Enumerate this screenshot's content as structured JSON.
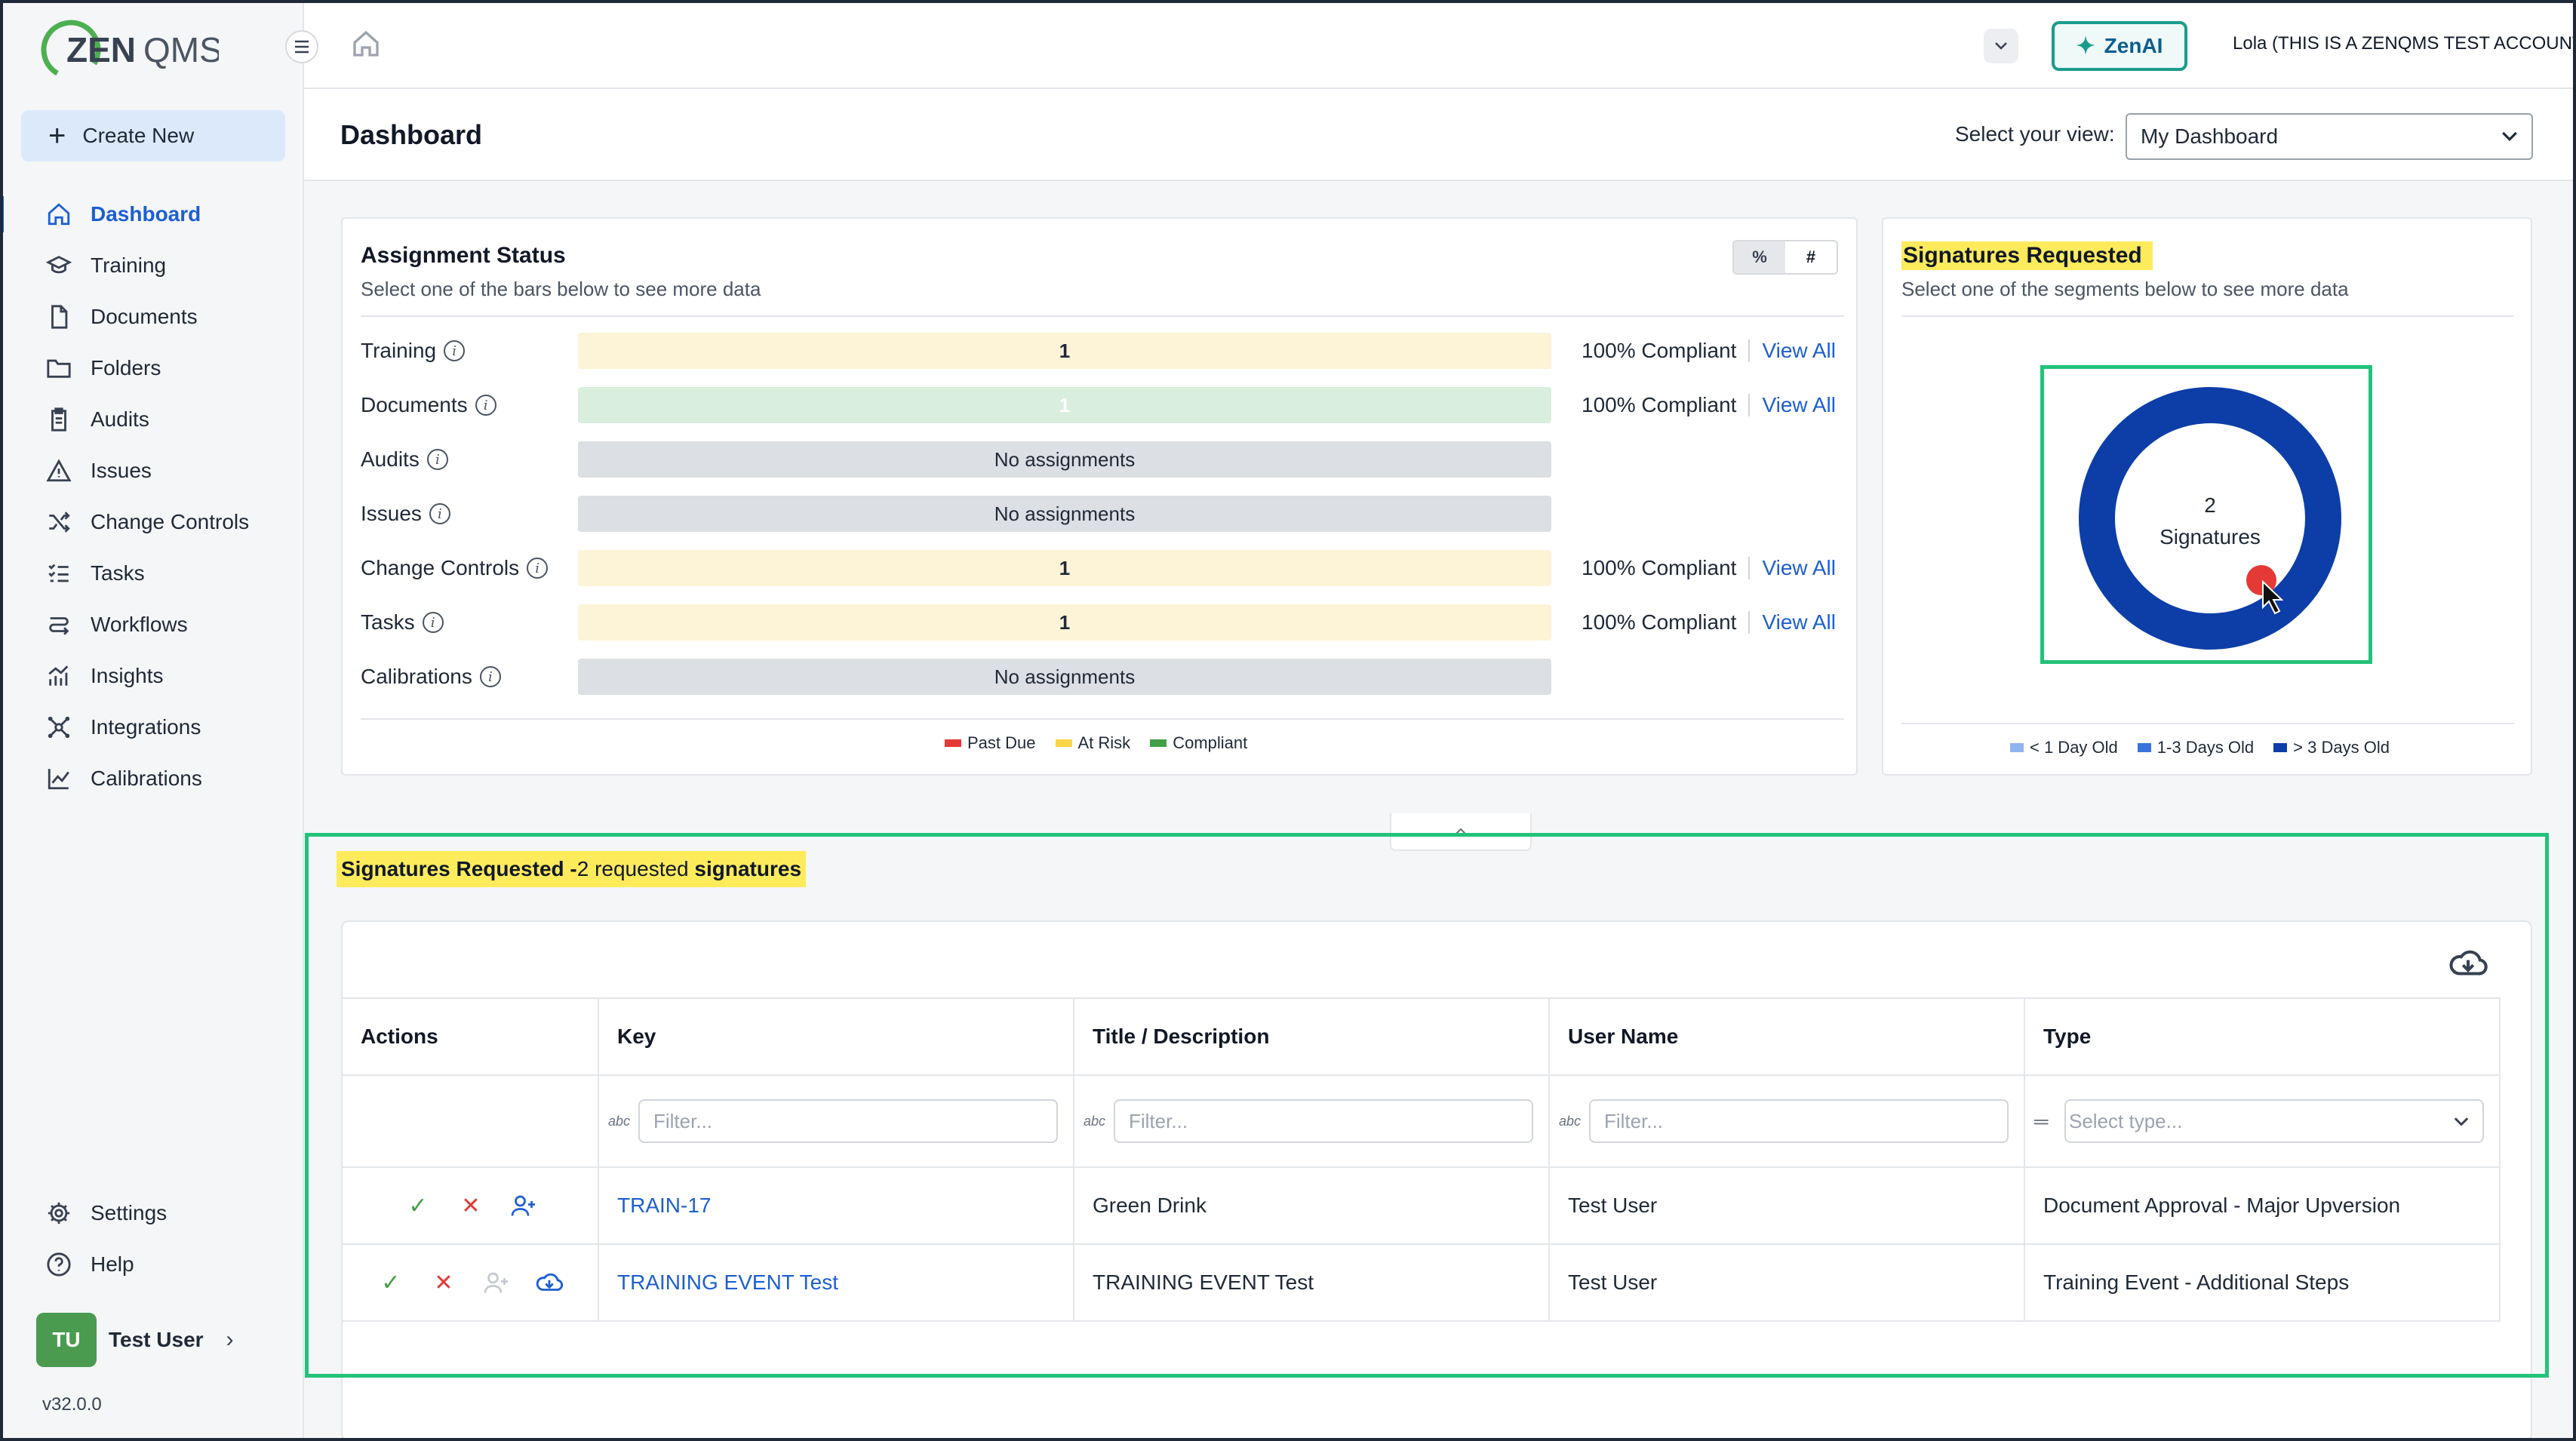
{
  "app": {
    "logo_text": "ZENQMS",
    "version": "v32.0.0"
  },
  "sidebar": {
    "create_label": "Create New",
    "items": [
      {
        "label": "Dashboard",
        "icon": "home-icon"
      },
      {
        "label": "Training",
        "icon": "graduation-cap-icon"
      },
      {
        "label": "Documents",
        "icon": "document-icon"
      },
      {
        "label": "Folders",
        "icon": "folder-icon"
      },
      {
        "label": "Audits",
        "icon": "clipboard-icon"
      },
      {
        "label": "Issues",
        "icon": "warning-icon"
      },
      {
        "label": "Change Controls",
        "icon": "shuffle-icon"
      },
      {
        "label": "Tasks",
        "icon": "task-list-icon"
      },
      {
        "label": "Workflows",
        "icon": "workflow-icon"
      },
      {
        "label": "Insights",
        "icon": "insights-icon"
      },
      {
        "label": "Integrations",
        "icon": "integrations-icon"
      },
      {
        "label": "Calibrations",
        "icon": "chart-line-icon"
      }
    ],
    "bottom": [
      {
        "label": "Settings",
        "icon": "gear-icon"
      },
      {
        "label": "Help",
        "icon": "help-icon"
      }
    ],
    "user": {
      "initials": "TU",
      "name": "Test User"
    }
  },
  "topbar": {
    "zenai_label": "ZenAI",
    "account": "Lola (THIS IS A ZENQMS TEST ACCOUNT)"
  },
  "page": {
    "title": "Dashboard",
    "view_label": "Select your view:",
    "view_value": "My Dashboard"
  },
  "assignment_status": {
    "title": "Assignment Status",
    "subtitle": "Select one of the bars below to see more data",
    "toggle": [
      "%",
      "#"
    ],
    "rows": [
      {
        "label": "Training",
        "bar": "1",
        "status": "100% Compliant",
        "link": "View All"
      },
      {
        "label": "Documents",
        "bar": "1",
        "status": "100% Compliant",
        "link": "View All"
      },
      {
        "label": "Audits",
        "bar": "No assignments",
        "status": "",
        "link": ""
      },
      {
        "label": "Issues",
        "bar": "No assignments",
        "status": "",
        "link": ""
      },
      {
        "label": "Change Controls",
        "bar": "1",
        "status": "100% Compliant",
        "link": "View All"
      },
      {
        "label": "Tasks",
        "bar": "1",
        "status": "100% Compliant",
        "link": "View All"
      },
      {
        "label": "Calibrations",
        "bar": "No assignments",
        "status": "",
        "link": ""
      }
    ],
    "legend": [
      {
        "label": "Past Due",
        "color": "#e53935"
      },
      {
        "label": "At Risk",
        "color": "#f9d548"
      },
      {
        "label": "Compliant",
        "color": "#43a047"
      }
    ]
  },
  "signatures_card": {
    "title": "Signatures Requested",
    "subtitle": "Select one of the segments below to see more data",
    "count": "2",
    "count_label": "Signatures",
    "legend": [
      {
        "label": "< 1 Day Old",
        "color": "#8fb4ef"
      },
      {
        "label": "1-3 Days Old",
        "color": "#3b73dd"
      },
      {
        "label": "> 3 Days Old",
        "color": "#0d3ea8"
      }
    ]
  },
  "signatures_table": {
    "heading_bold": "Signatures Requested - ",
    "heading_count": "2",
    "heading_rest": " requested ",
    "heading_tail": "signatures",
    "columns": [
      "Actions",
      "Key",
      "Title / Description",
      "User Name",
      "Type"
    ],
    "filter_placeholder": "Filter...",
    "type_placeholder": "Select type...",
    "rows": [
      {
        "key": "TRAIN-17",
        "title": "Green Drink",
        "user": "Test User",
        "type": "Document Approval - Major Upversion"
      },
      {
        "key": "TRAINING EVENT Test",
        "title": "TRAINING EVENT Test",
        "user": "Test User",
        "type": "Training Event - Additional Steps"
      }
    ]
  }
}
